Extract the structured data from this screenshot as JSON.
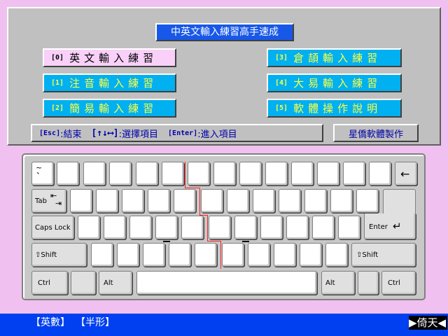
{
  "window": {
    "title": "中英文輸入練習高手速成"
  },
  "menu": {
    "items": [
      {
        "num": "[0]",
        "label": "英文輸入練習"
      },
      {
        "num": "[1]",
        "label": "注音輸入練習"
      },
      {
        "num": "[2]",
        "label": "簡易輸入練習"
      },
      {
        "num": "[3]",
        "label": "倉頡輸入練習"
      },
      {
        "num": "[4]",
        "label": "大易輸入練習"
      },
      {
        "num": "[5]",
        "label": "軟體操作說明"
      }
    ],
    "selected_index": 0
  },
  "help": {
    "esc_key": "[Esc]",
    "esc_text": ":結束",
    "arrow_key": "[↑↓⟷]",
    "arrow_text": ":選擇項目",
    "enter_key": "[Enter]",
    "enter_text": ":進入項目"
  },
  "credit": "星僑軟體製作",
  "keyboard": {
    "tilde": "~",
    "tilde_sub": "`",
    "backspace": "←",
    "tab": "Tab",
    "caps": "Caps Lock",
    "enter": "Enter",
    "lshift": "⇧Shift",
    "rshift": "⇧Shift",
    "ctrl": "Ctrl",
    "alt": "Alt"
  },
  "status": {
    "input_mode": "【英數】",
    "width_mode": "【半形】",
    "brand": "▶倚天◀"
  },
  "colors": {
    "background": "#f0c0f0",
    "panel": "#c0c0c0",
    "menu_button": "#00b0f0",
    "menu_text": "#ffff40",
    "selected_button": "#f8d0f8",
    "title_bar": "#1858e8",
    "status_bar": "#0040f0"
  }
}
